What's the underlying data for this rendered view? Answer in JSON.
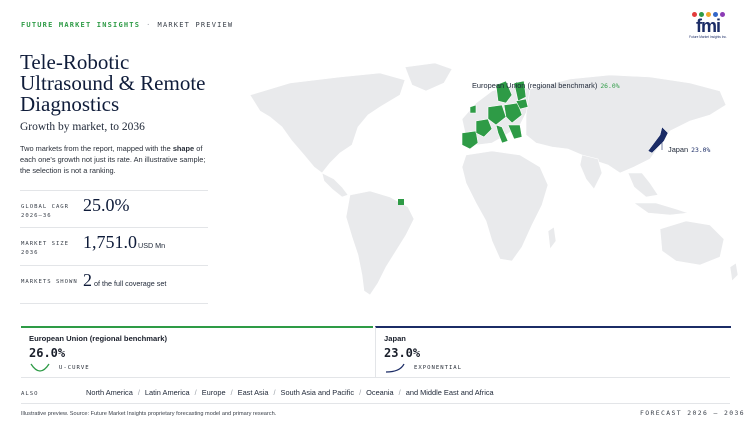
{
  "header": {
    "brand": "FUTURE MARKET INSIGHTS",
    "separator": "·",
    "kind": "MARKET PREVIEW"
  },
  "logo": {
    "mark": "fmi",
    "tagline": "Future Market Insights Inc.",
    "dot_colors": [
      "#e23b3b",
      "#2e9b46",
      "#f0a52a",
      "#3467c8",
      "#8c3bb5"
    ]
  },
  "title": "Tele-Robotic Ultrasound & Remote Diagnostics",
  "subtitle": "Growth by market, to 2036",
  "description": {
    "part1": "Two markets from the report, mapped with the ",
    "bold": "shape",
    "part2": " of each one's growth not just its rate. An illustrative sample; the selection is not a ranking."
  },
  "stats": [
    {
      "label": "GLOBAL CAGR 2026–36",
      "value": "25.0%",
      "unit": ""
    },
    {
      "label": "MARKET SIZE 2036",
      "value": "1,751.0",
      "unit": "USD Mn"
    },
    {
      "label": "MARKETS SHOWN",
      "value": "2",
      "unit": "of the full coverage set"
    }
  ],
  "map_callouts": {
    "eu": {
      "name": "European Union (regional benchmark)",
      "value": "26.0%"
    },
    "jp": {
      "name": "Japan",
      "value": "23.0%"
    }
  },
  "cards": [
    {
      "name": "European Union (regional benchmark)",
      "value": "26.0%",
      "shape": "U-CURVE",
      "color": "#2e9b46"
    },
    {
      "name": "Japan",
      "value": "23.0%",
      "shape": "EXPONENTIAL",
      "color": "#1b2c66"
    }
  ],
  "also": {
    "label": "ALSO",
    "regions": [
      "North America",
      "Latin America",
      "Europe",
      "East Asia",
      "South Asia and Pacific",
      "Oceania",
      "and Middle East and Africa"
    ]
  },
  "footnote": "Illustrative preview. Source: Future Market Insights proprietary forecasting model and primary research.",
  "forecast": "FORECAST 2026 – 2036",
  "colors": {
    "accent_green": "#2e9b46",
    "navy": "#1b2c66",
    "land": "#e9eaec",
    "text": "#1a1f2b"
  }
}
